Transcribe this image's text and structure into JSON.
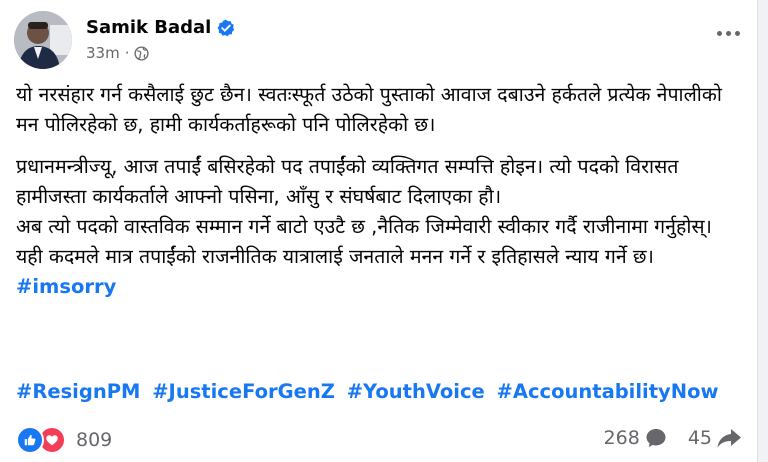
{
  "post": {
    "author": "Samik Badal",
    "time": "33m",
    "paragraphs": [
      "यो नरसंहार गर्न कसैलाई छुट छैन। स्वतःस्फूर्त उठेको पुस्ताको आवाज दबाउने हर्कतले प्रत्येक नेपालीको मन पोलिरहेको छ, हामी कार्यकर्ताहरूको पनि पोलिरहेको छ।",
      "प्रधानमन्त्रीज्यू, आज तपाईं बसिरहेको पद तपाईंको व्यक्तिगत सम्पत्ति होइन। त्यो पदको विरासत हामीजस्ता कार्यकर्ताले आफ्नो पसिना, आँसु र संघर्षबाट दिलाएका हौ।",
      "अब त्यो पदको वास्तविक सम्मान गर्ने बाटो एउटै छ ,नैतिक जिम्मेवारी स्वीकार गर्दै राजीनामा गर्नुहोस्। यही कदमले मात्र तपाईंको राजनीतिक यात्रालाई जनताले मनन गर्ने र इतिहासले न्याय गर्ने छ।"
    ],
    "inline_hashtag": "#imsorry",
    "hashtags": [
      "#ResignPM",
      "#JusticeForGenZ",
      "#YouthVoice",
      "#AccountabilityNow"
    ],
    "reaction_count": "809",
    "comment_count": "268",
    "share_count": "45"
  },
  "icons": {
    "verified": "verified-badge-icon",
    "privacy": "globe-icon",
    "more": "more-options-icon",
    "like": "like-icon",
    "love": "love-icon",
    "comment": "comment-icon",
    "share": "share-icon"
  },
  "colors": {
    "link": "#1877f2",
    "secondary_text": "#65676b",
    "love": "#f33e58"
  }
}
